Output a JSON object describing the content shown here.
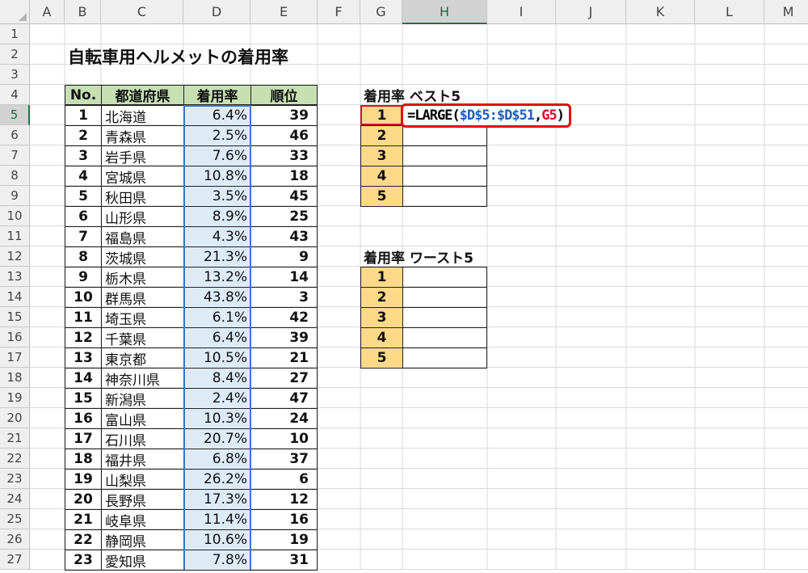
{
  "columns": [
    "A",
    "B",
    "C",
    "D",
    "E",
    "F",
    "G",
    "H",
    "I",
    "J",
    "K",
    "L",
    "M"
  ],
  "selected_column": "H",
  "rows": [
    "1",
    "2",
    "3",
    "4",
    "5",
    "6",
    "7",
    "8",
    "9",
    "10",
    "11",
    "12",
    "13",
    "14",
    "15",
    "16",
    "17",
    "18",
    "19",
    "20",
    "21",
    "22",
    "23",
    "24",
    "25",
    "26",
    "27"
  ],
  "selected_row": "5",
  "sheet": {
    "title": "自転車用ヘルメットの着用率",
    "table_headers": {
      "no": "No.",
      "pref": "都道府県",
      "rate": "着用率",
      "rank": "順位"
    },
    "table_rows": [
      {
        "no": "1",
        "pref": "北海道",
        "rate": "6.4%",
        "rank": "39"
      },
      {
        "no": "2",
        "pref": "青森県",
        "rate": "2.5%",
        "rank": "46"
      },
      {
        "no": "3",
        "pref": "岩手県",
        "rate": "7.6%",
        "rank": "33"
      },
      {
        "no": "4",
        "pref": "宮城県",
        "rate": "10.8%",
        "rank": "18"
      },
      {
        "no": "5",
        "pref": "秋田県",
        "rate": "3.5%",
        "rank": "45"
      },
      {
        "no": "6",
        "pref": "山形県",
        "rate": "8.9%",
        "rank": "25"
      },
      {
        "no": "7",
        "pref": "福島県",
        "rate": "4.3%",
        "rank": "43"
      },
      {
        "no": "8",
        "pref": "茨城県",
        "rate": "21.3%",
        "rank": "9"
      },
      {
        "no": "9",
        "pref": "栃木県",
        "rate": "13.2%",
        "rank": "14"
      },
      {
        "no": "10",
        "pref": "群馬県",
        "rate": "43.8%",
        "rank": "3"
      },
      {
        "no": "11",
        "pref": "埼玉県",
        "rate": "6.1%",
        "rank": "42"
      },
      {
        "no": "12",
        "pref": "千葉県",
        "rate": "6.4%",
        "rank": "39"
      },
      {
        "no": "13",
        "pref": "東京都",
        "rate": "10.5%",
        "rank": "21"
      },
      {
        "no": "14",
        "pref": "神奈川県",
        "rate": "8.4%",
        "rank": "27"
      },
      {
        "no": "15",
        "pref": "新潟県",
        "rate": "2.4%",
        "rank": "47"
      },
      {
        "no": "16",
        "pref": "富山県",
        "rate": "10.3%",
        "rank": "24"
      },
      {
        "no": "17",
        "pref": "石川県",
        "rate": "20.7%",
        "rank": "10"
      },
      {
        "no": "18",
        "pref": "福井県",
        "rate": "6.8%",
        "rank": "37"
      },
      {
        "no": "19",
        "pref": "山梨県",
        "rate": "26.2%",
        "rank": "6"
      },
      {
        "no": "20",
        "pref": "長野県",
        "rate": "17.3%",
        "rank": "12"
      },
      {
        "no": "21",
        "pref": "岐阜県",
        "rate": "11.4%",
        "rank": "16"
      },
      {
        "no": "22",
        "pref": "静岡県",
        "rate": "10.6%",
        "rank": "19"
      },
      {
        "no": "23",
        "pref": "愛知県",
        "rate": "7.8%",
        "rank": "31"
      }
    ],
    "best": {
      "label": "着用率 ベスト5",
      "ranks": [
        "1",
        "2",
        "3",
        "4",
        "5"
      ]
    },
    "worst": {
      "label": "着用率 ワースト5",
      "ranks": [
        "1",
        "2",
        "3",
        "4",
        "5"
      ]
    },
    "formula": {
      "prefix": "=LARGE(",
      "ref1": "$D$5:$D$51",
      "sep": ",",
      "ref2": "G5",
      "suffix": ")"
    }
  },
  "colors": {
    "header_green": "#c6e0b4",
    "rank_gold": "#ffd98a",
    "highlight_red": "#e60012",
    "range_blue": "#3b78c6"
  }
}
